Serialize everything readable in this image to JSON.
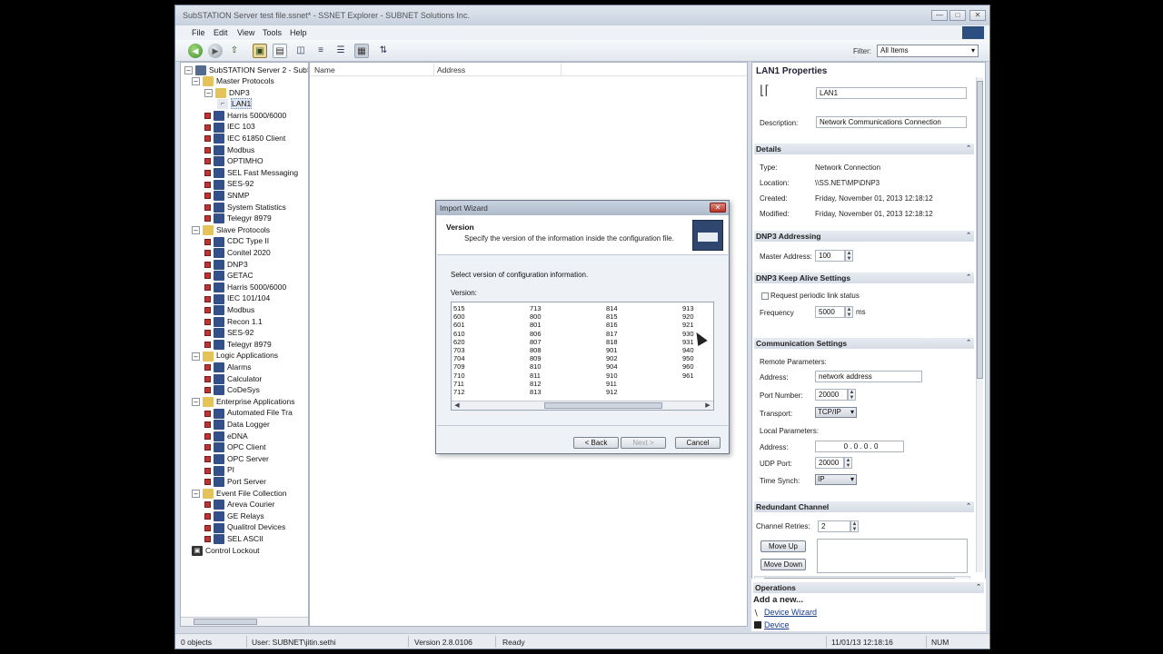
{
  "window": {
    "title": "SubSTATION Server test file.ssnet* - SSNET Explorer - SUBNET Solutions Inc."
  },
  "menu": [
    "File",
    "Edit",
    "View",
    "Tools",
    "Help"
  ],
  "filter": {
    "label": "Filter:",
    "value": "All Items"
  },
  "tree": {
    "root": "SubSTATION Server 2 - SubST",
    "items": [
      {
        "label": "Master Protocols",
        "level": 1,
        "kind": "folder"
      },
      {
        "label": "DNP3",
        "level": 2,
        "kind": "folder"
      },
      {
        "label": "LAN1",
        "level": 3,
        "kind": "leaf"
      },
      {
        "label": "Harris 5000/6000",
        "level": 2,
        "kind": "proto"
      },
      {
        "label": "IEC 103",
        "level": 2,
        "kind": "proto"
      },
      {
        "label": "IEC 61850 Client",
        "level": 2,
        "kind": "proto"
      },
      {
        "label": "Modbus",
        "level": 2,
        "kind": "proto"
      },
      {
        "label": "OPTIMHO",
        "level": 2,
        "kind": "proto"
      },
      {
        "label": "SEL Fast Messaging",
        "level": 2,
        "kind": "proto"
      },
      {
        "label": "SES-92",
        "level": 2,
        "kind": "proto"
      },
      {
        "label": "SNMP",
        "level": 2,
        "kind": "proto"
      },
      {
        "label": "System Statistics",
        "level": 2,
        "kind": "proto"
      },
      {
        "label": "Telegyr 8979",
        "level": 2,
        "kind": "proto"
      },
      {
        "label": "Slave Protocols",
        "level": 1,
        "kind": "folder"
      },
      {
        "label": "CDC Type II",
        "level": 2,
        "kind": "proto"
      },
      {
        "label": "Conitel 2020",
        "level": 2,
        "kind": "proto"
      },
      {
        "label": "DNP3",
        "level": 2,
        "kind": "proto"
      },
      {
        "label": "GETAC",
        "level": 2,
        "kind": "proto"
      },
      {
        "label": "Harris 5000/6000",
        "level": 2,
        "kind": "proto"
      },
      {
        "label": "IEC 101/104",
        "level": 2,
        "kind": "proto"
      },
      {
        "label": "Modbus",
        "level": 2,
        "kind": "proto"
      },
      {
        "label": "Recon 1.1",
        "level": 2,
        "kind": "proto"
      },
      {
        "label": "SES-92",
        "level": 2,
        "kind": "proto"
      },
      {
        "label": "Telegyr 8979",
        "level": 2,
        "kind": "proto"
      },
      {
        "label": "Logic Applications",
        "level": 1,
        "kind": "folder"
      },
      {
        "label": "Alarms",
        "level": 2,
        "kind": "proto"
      },
      {
        "label": "Calculator",
        "level": 2,
        "kind": "proto"
      },
      {
        "label": "CoDeSys",
        "level": 2,
        "kind": "proto"
      },
      {
        "label": "Enterprise Applications",
        "level": 1,
        "kind": "folder"
      },
      {
        "label": "Automated File Tra",
        "level": 2,
        "kind": "proto"
      },
      {
        "label": "Data Logger",
        "level": 2,
        "kind": "proto"
      },
      {
        "label": "eDNA",
        "level": 2,
        "kind": "proto"
      },
      {
        "label": "OPC Client",
        "level": 2,
        "kind": "proto"
      },
      {
        "label": "OPC Server",
        "level": 2,
        "kind": "proto"
      },
      {
        "label": "PI",
        "level": 2,
        "kind": "proto"
      },
      {
        "label": "Port Server",
        "level": 2,
        "kind": "proto"
      },
      {
        "label": "Event File Collection",
        "level": 1,
        "kind": "folder"
      },
      {
        "label": "Areva Courier",
        "level": 2,
        "kind": "proto"
      },
      {
        "label": "GE Relays",
        "level": 2,
        "kind": "proto"
      },
      {
        "label": "Qualitrol Devices",
        "level": 2,
        "kind": "proto"
      },
      {
        "label": "SEL ASCII",
        "level": 2,
        "kind": "proto"
      },
      {
        "label": "Control Lockout",
        "level": 1,
        "kind": "lock"
      }
    ]
  },
  "list": {
    "col_name": "Name",
    "col_address": "Address"
  },
  "properties": {
    "title": "LAN1 Properties",
    "name_value": "LAN1",
    "description_label": "Description:",
    "description_value": "Network Communications Connection",
    "details": {
      "header": "Details",
      "type_label": "Type:",
      "type_value": "Network Connection",
      "location_label": "Location:",
      "location_value": "\\\\SS.NET\\MP\\DNP3",
      "created_label": "Created:",
      "created_value": "Friday, November 01, 2013 12:18:12",
      "modified_label": "Modified:",
      "modified_value": "Friday, November 01, 2013 12:18:12"
    },
    "dnp3": {
      "header": "DNP3 Addressing",
      "master_label": "Master Address:",
      "master_value": "100"
    },
    "keepalive": {
      "header": "DNP3 Keep Alive Settings",
      "request_label": "Request periodic link status",
      "frequency_label": "Frequency",
      "frequency_value": "5000",
      "frequency_unit": "ms"
    },
    "comm": {
      "header": "Communication Settings",
      "remote_label": "Remote Parameters:",
      "address_label": "Address:",
      "address_value": "network address",
      "port_label": "Port Number:",
      "port_value": "20000",
      "transport_label": "Transport:",
      "transport_value": "TCP/IP",
      "local_label": "Local Parameters:",
      "local_address_label": "Address:",
      "local_address_value": "0 . 0 . 0 . 0",
      "udp_label": "UDP Port:",
      "udp_value": "20000",
      "timesync_label": "Time Synch:",
      "timesync_value": "IP"
    },
    "redundant": {
      "header": "Redundant Channel",
      "retries_label": "Channel Retries:",
      "retries_value": "2",
      "move_up": "Move Up",
      "move_down": "Move Down"
    }
  },
  "operations": {
    "header": "Operations",
    "add_new": "Add a new...",
    "device_wizard": "Device Wizard",
    "device": "Device"
  },
  "status": {
    "objects": "0 objects",
    "user": "User: SUBNET\\jitin.sethi",
    "version": "Version 2.8.0106",
    "state": "Ready",
    "datetime": "11/01/13 12:18:16",
    "num": "NUM"
  },
  "dialog": {
    "title": "Import Wizard",
    "heading": "Version",
    "subtext": "Specify the version of the information inside the configuration file.",
    "prompt": "Select version of configuration information.",
    "version_label": "Version:",
    "columns": [
      [
        "515",
        "600",
        "601",
        "610",
        "620",
        "703",
        "704",
        "709",
        "710",
        "711",
        "712"
      ],
      [
        "713",
        "800",
        "801",
        "806",
        "807",
        "808",
        "809",
        "810",
        "811",
        "812",
        "813"
      ],
      [
        "814",
        "815",
        "816",
        "817",
        "818",
        "901",
        "902",
        "904",
        "910",
        "911",
        "912"
      ],
      [
        "913",
        "920",
        "921",
        "930",
        "931",
        "940",
        "950",
        "960",
        "961"
      ]
    ],
    "back": "< Back",
    "next": "Next >",
    "cancel": "Cancel"
  }
}
